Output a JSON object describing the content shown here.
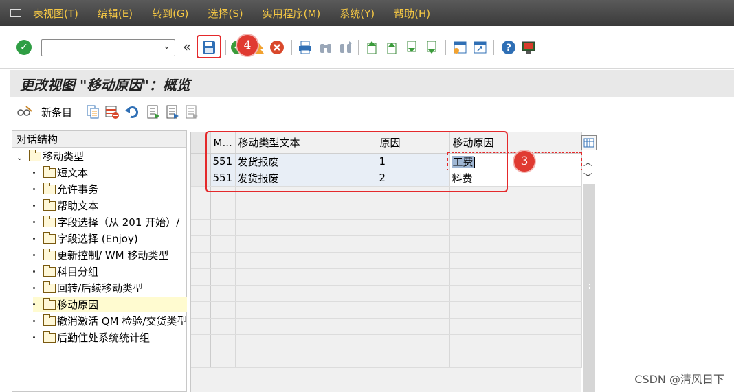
{
  "menubar": {
    "items": [
      "表视图(T)",
      "编辑(E)",
      "转到(G)",
      "选择(S)",
      "实用程序(M)",
      "系统(Y)",
      "帮助(H)"
    ]
  },
  "toolbar": {
    "command_value": "",
    "save_label": "Save",
    "icons": [
      "enter-icon",
      "save-icon",
      "back-icon",
      "exit-icon",
      "cancel-icon",
      "print-icon",
      "find-icon",
      "find-next-icon",
      "first-page-icon",
      "previous-page-icon",
      "next-page-icon",
      "last-page-icon",
      "create-session-icon",
      "shortcut-icon",
      "help-icon",
      "layout-icon"
    ]
  },
  "annotations": {
    "badge_save": "4",
    "badge_cell": "3",
    "highlight_color": "#e4292b"
  },
  "title": "更改视图 \"移动原因\"：概览",
  "app_toolbar": {
    "new_entries": "新条目"
  },
  "tree": {
    "header": "对话结构",
    "root": "移动类型",
    "children": [
      "短文本",
      "允许事务",
      "帮助文本",
      "字段选择（从 201 开始）/",
      "字段选择 (Enjoy)",
      "更新控制/ WM 移动类型",
      "科目分组",
      "回转/后续移动类型",
      "移动原因",
      "撤消激活 QM 检验/交货类型",
      "后勤住处系统统计组"
    ],
    "selected_index": 8
  },
  "table": {
    "columns": [
      "M...",
      "移动类型文本",
      "原因",
      "移动原因"
    ],
    "rows": [
      {
        "mvt": "551",
        "text": "发货报废",
        "reason": "1",
        "reason_text": "工费"
      },
      {
        "mvt": "551",
        "text": "发货报废",
        "reason": "2",
        "reason_text": "料费"
      }
    ]
  },
  "watermark": "CSDN @清风日下"
}
